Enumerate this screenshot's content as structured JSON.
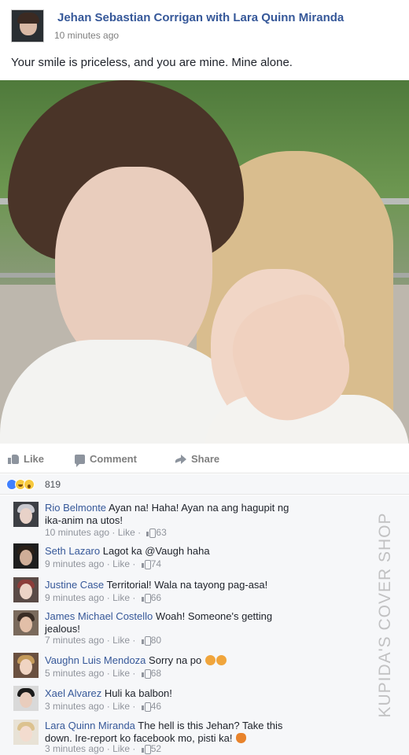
{
  "post": {
    "author": "Jehan Sebastian Corrigan with Lara Quinn Miranda",
    "time": "10 minutes ago",
    "text": "Your smile is priceless, and you are mine. Mine alone."
  },
  "actions": {
    "like_label": "Like",
    "comment_label": "Comment",
    "share_label": "Share"
  },
  "reactions": {
    "icons": [
      "like-reaction-icon",
      "haha-reaction-icon",
      "wow-reaction-icon"
    ],
    "count": "819"
  },
  "comments": [
    {
      "name": "Rio Belmonte",
      "text": "Ayan na! Haha! Ayan na ang hagupit ng ika-anim na utos!",
      "time": "10 minutes ago",
      "like": "Like",
      "likes": "63"
    },
    {
      "name": "Seth Lazaro",
      "text": "Lagot ka @Vaugh haha",
      "time": "9 minutes ago",
      "like": "Like",
      "likes": "74"
    },
    {
      "name": "Justine Case",
      "text": "Territorial! Wala na tayong pag-asa!",
      "time": "9 minutes ago",
      "like": "Like",
      "likes": "66"
    },
    {
      "name": "James Michael Costello",
      "text": "Woah! Someone's getting jealous!",
      "time": "7 minutes ago",
      "like": "Like",
      "likes": "80"
    },
    {
      "name": "Vaughn Luis Mendoza",
      "text": "Sorry na po",
      "time": "5 minutes ago",
      "like": "Like",
      "likes": "68"
    },
    {
      "name": "Xael Alvarez",
      "text": "Huli ka balbon!",
      "time": "3 minutes ago",
      "like": "Like",
      "likes": "46"
    },
    {
      "name": "Lara Quinn Miranda",
      "text": "The hell is this Jehan? Take this down. Ire-report ko facebook mo, pisti ka!",
      "time": "3 minutes ago",
      "like": "Like",
      "likes": "52"
    }
  ],
  "watermark": "KUPIDA'S COVER SHOP",
  "colors": {
    "name_link": "#365899",
    "meta_gray": "#90949c",
    "like_blue": "#4080ff",
    "comments_bg": "#f6f7f9"
  }
}
